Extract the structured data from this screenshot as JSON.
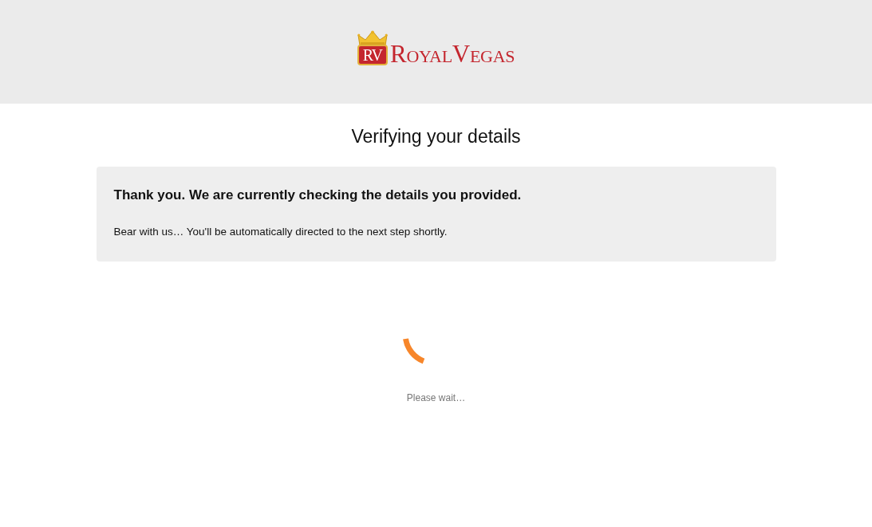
{
  "header": {
    "logo": {
      "monogram": "RV",
      "wordmark": "RoyalVegas"
    }
  },
  "title": "Verifying your details",
  "notice": {
    "heading": "Thank you. We are currently checking the details you provided.",
    "message": "Bear with us… You'll be automatically directed to the next step shortly."
  },
  "loading": {
    "label": "Please wait…"
  }
}
